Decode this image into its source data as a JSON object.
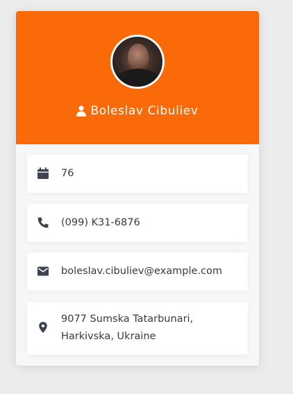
{
  "profile": {
    "name": "Boleslav Cibuliev",
    "age": "76",
    "phone": "(099) K31-6876",
    "email": "boleslav.cibuliev@example.com",
    "address_line1": "9077 Sumska Tatarbunari,",
    "address_line2": "Harkivska, Ukraine"
  },
  "colors": {
    "header": "#fb6a08",
    "icon": "#3d4451"
  },
  "icons": [
    "user-icon",
    "calendar-icon",
    "phone-icon",
    "email-icon",
    "location-icon"
  ]
}
